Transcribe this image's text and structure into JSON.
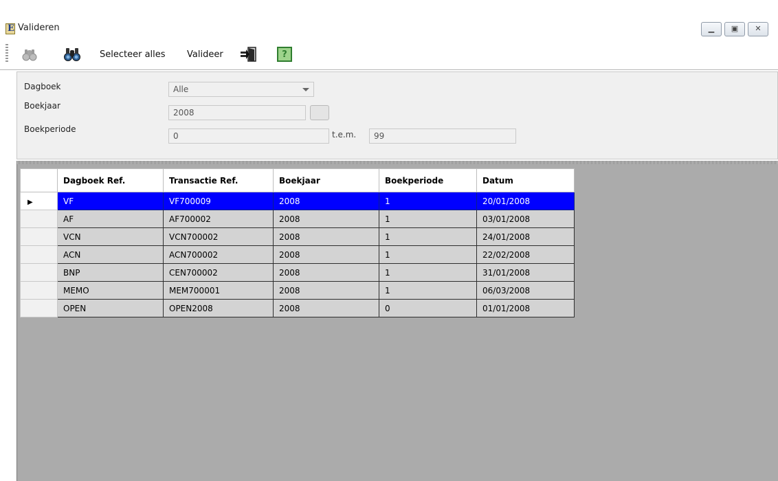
{
  "window": {
    "title": "Valideren",
    "controls": [
      "minimize-icon",
      "maximize-icon",
      "close-icon"
    ]
  },
  "toolbar": {
    "items": [
      {
        "name": "search-disabled",
        "icon": "binoculars-grey-icon"
      },
      {
        "name": "search",
        "icon": "binoculars-icon"
      },
      {
        "name": "select-all",
        "label": "Selecteer alles"
      },
      {
        "name": "validate",
        "label": "Valideer"
      },
      {
        "name": "exit",
        "icon": "exit-door-icon"
      },
      {
        "name": "help",
        "icon": "help-icon",
        "glyph": "?"
      }
    ]
  },
  "filters": {
    "dagboek": {
      "label": "Dagboek",
      "value": "Alle"
    },
    "boekjaar": {
      "label": "Boekjaar",
      "value": "2008"
    },
    "boekperiode": {
      "label": "Boekperiode",
      "from": "0",
      "to_label": "t.e.m.",
      "to": "99"
    }
  },
  "grid": {
    "columns": [
      "Dagboek Ref.",
      "Transactie Ref.",
      "Boekjaar",
      "Boekperiode",
      "Datum"
    ],
    "rows": [
      [
        "VF",
        "VF700009",
        "2008",
        "1",
        "20/01/2008"
      ],
      [
        "AF",
        "AF700002",
        "2008",
        "1",
        "03/01/2008"
      ],
      [
        "VCN",
        "VCN700002",
        "2008",
        "1",
        "24/01/2008"
      ],
      [
        "ACN",
        "ACN700002",
        "2008",
        "1",
        "22/02/2008"
      ],
      [
        "BNP",
        "CEN700002",
        "2008",
        "1",
        "31/01/2008"
      ],
      [
        "MEMO",
        "MEM700001",
        "2008",
        "1",
        "06/03/2008"
      ],
      [
        "OPEN",
        "OPEN2008",
        "2008",
        "0",
        "01/01/2008"
      ]
    ],
    "selected_row": 0
  },
  "colors": {
    "selection": "#0000ff",
    "grid_background": "#ababab",
    "row_background": "#d3d3d3"
  }
}
